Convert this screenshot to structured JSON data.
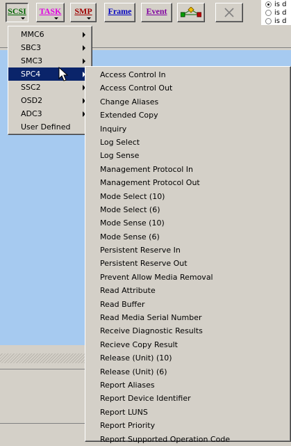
{
  "toolbar": {
    "buttons": [
      {
        "label": "SCSI",
        "color": "#006400"
      },
      {
        "label": "TASK",
        "color": "#e000e0"
      },
      {
        "label": "SMP",
        "color": "#a00000"
      },
      {
        "label": "Frame",
        "color": "#0000c0"
      },
      {
        "label": "Event",
        "color": "#8000a0"
      }
    ],
    "radios": [
      {
        "label": "is d",
        "checked": true
      },
      {
        "label": "is d",
        "checked": false
      },
      {
        "label": "is d",
        "checked": false
      }
    ]
  },
  "main_menu": {
    "items": [
      {
        "label": "MMC6",
        "has_submenu": true
      },
      {
        "label": "SBC3",
        "has_submenu": true
      },
      {
        "label": "SMC3",
        "has_submenu": true
      },
      {
        "label": "SPC4",
        "has_submenu": true,
        "active": true
      },
      {
        "label": "SSC2",
        "has_submenu": true
      },
      {
        "label": "OSD2",
        "has_submenu": true
      },
      {
        "label": "ADC3",
        "has_submenu": true
      },
      {
        "label": "User Defined",
        "has_submenu": false
      }
    ]
  },
  "submenu": {
    "items": [
      "Access Control In",
      "Access Control Out",
      "Change Aliases",
      "Extended Copy",
      "Inquiry",
      "Log Select",
      "Log Sense",
      "Management Protocol In",
      "Management Protocol Out",
      "Mode Select (10)",
      "Mode Select (6)",
      "Mode Sense (10)",
      "Mode Sense (6)",
      "Persistent Reserve In",
      "Persistent Reserve Out",
      "Prevent Allow Media Removal",
      "Read Attribute",
      "Read Buffer",
      "Read Media Serial Number",
      "Receive Diagnostic Results",
      "Recieve Copy Result",
      "Release (Unit) (10)",
      "Release (Unit) (6)",
      "Report Aliases",
      "Report Device Identifier",
      "Report LUNS",
      "Report Priority",
      "Report Supported Operation Code"
    ]
  }
}
